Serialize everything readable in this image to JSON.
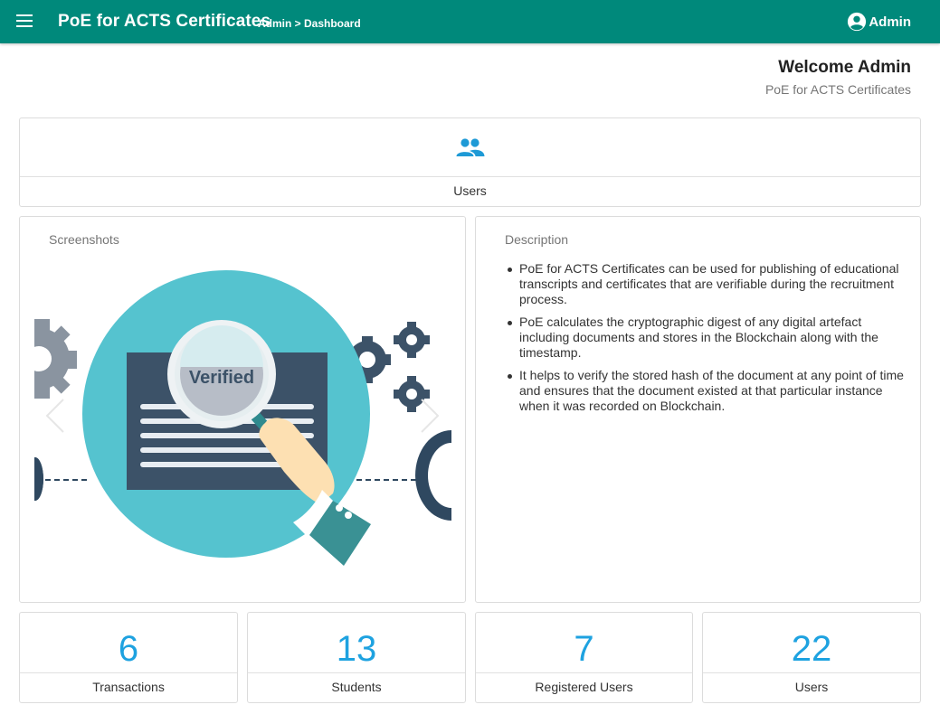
{
  "header": {
    "app_title": "PoE for ACTS Certificates",
    "breadcrumb": "Admin > Dashboard",
    "user_label": "Admin",
    "icons": {
      "menu": "menu-icon",
      "account": "account-circle-icon"
    }
  },
  "welcome": {
    "title": "Welcome Admin",
    "subtitle": "PoE for ACTS Certificates"
  },
  "users_card": {
    "label": "Users",
    "icon": "people-icon"
  },
  "screenshots": {
    "heading": "Screenshots",
    "slide_text": "Verified"
  },
  "description": {
    "heading": "Description",
    "items": [
      "PoE for ACTS Certificates can be used for publishing of educational transcripts and certificates that are verifiable during the recruitment process.",
      "PoE calculates the cryptographic digest of any digital artefact including documents and stores in the Blockchain along with the timestamp.",
      "It helps to verify the stored hash of the document at any point of time and ensures that the document existed at that particular instance when it was recorded on Blockchain."
    ]
  },
  "stats": [
    {
      "value": "6",
      "label": "Transactions"
    },
    {
      "value": "13",
      "label": "Students"
    },
    {
      "value": "7",
      "label": "Registered Users"
    },
    {
      "value": "22",
      "label": "Users"
    }
  ],
  "colors": {
    "header_bg": "#00897b",
    "stat_number": "#1ea2e0",
    "people_icon": "#1e9ad6"
  }
}
